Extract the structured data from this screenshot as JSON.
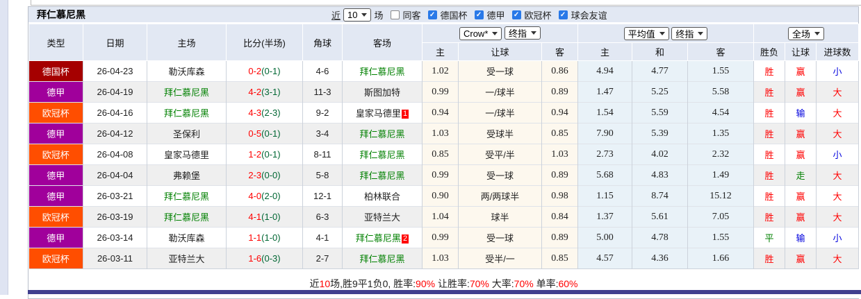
{
  "title": "拜仁慕尼黑",
  "icons": {
    "checkmark": "✓"
  },
  "colors": {
    "league_cup": "#a50000",
    "league_liga": "#a0009b",
    "league_ucl": "#ff4e00",
    "win_red": "#ff0000",
    "draw_green": "#008000",
    "lose_blue": "#0000dd",
    "header_bg": "#e2e8f3",
    "crow_col_bg": "#fdf8ee",
    "avg_col_bg": "#e9f2f8",
    "bottom_bar": "#403f8e"
  },
  "filters": {
    "recent_label": "近",
    "recent_value": "10",
    "recent_suffix": "场",
    "checkboxes": [
      {
        "label": "同客",
        "state": "off"
      },
      {
        "label": "德国杯",
        "state": "on"
      },
      {
        "label": "德甲",
        "state": "on"
      },
      {
        "label": "欧冠杯",
        "state": "on"
      },
      {
        "label": "球会友谊",
        "state": "on"
      }
    ]
  },
  "header": {
    "selects": {
      "source": "Crow*",
      "final1": "终指",
      "average": "平均值",
      "final2": "终指",
      "scope": "全场"
    },
    "columns": [
      "类型",
      "日期",
      "主场",
      "比分(半场)",
      "角球",
      "客场"
    ],
    "odds_columns": [
      "主",
      "让球",
      "客"
    ],
    "avg_columns": [
      "主",
      "和",
      "客"
    ],
    "result_columns": [
      "胜负",
      "让球",
      "进球数"
    ]
  },
  "rows": [
    {
      "league": "德国杯",
      "league_code": "cup",
      "date": "26-04-23",
      "home": "勒沃库森",
      "home_color": "black",
      "home_badge": "",
      "score": "0-2",
      "half": "(0-1)",
      "corner": "4-6",
      "away": "拜仁慕尼黑",
      "away_color": "green",
      "away_badge": "",
      "o_home": "1.02",
      "o_hcp": "受一球",
      "o_away": "0.86",
      "a_home": "4.94",
      "a_draw": "4.77",
      "a_away": "1.55",
      "r_wdl": "胜",
      "r_wdl_c": "red",
      "r_hcp": "赢",
      "r_hcp_c": "red",
      "r_ou": "小",
      "r_ou_c": "blue"
    },
    {
      "league": "德甲",
      "league_code": "liga",
      "date": "26-04-19",
      "home": "拜仁慕尼黑",
      "home_color": "green",
      "home_badge": "",
      "score": "4-2",
      "half": "(3-1)",
      "corner": "11-3",
      "away": "斯图加特",
      "away_color": "black",
      "away_badge": "",
      "o_home": "0.99",
      "o_hcp": "一/球半",
      "o_away": "0.89",
      "a_home": "1.47",
      "a_draw": "5.25",
      "a_away": "5.58",
      "r_wdl": "胜",
      "r_wdl_c": "red",
      "r_hcp": "赢",
      "r_hcp_c": "red",
      "r_ou": "大",
      "r_ou_c": "red"
    },
    {
      "league": "欧冠杯",
      "league_code": "ucl",
      "date": "26-04-16",
      "home": "拜仁慕尼黑",
      "home_color": "green",
      "home_badge": "",
      "score": "4-3",
      "half": "(2-3)",
      "corner": "9-2",
      "away": "皇家马德里",
      "away_color": "black",
      "away_badge": "1",
      "o_home": "0.94",
      "o_hcp": "一/球半",
      "o_away": "0.94",
      "a_home": "1.54",
      "a_draw": "5.59",
      "a_away": "4.54",
      "r_wdl": "胜",
      "r_wdl_c": "red",
      "r_hcp": "输",
      "r_hcp_c": "blue",
      "r_ou": "大",
      "r_ou_c": "red"
    },
    {
      "league": "德甲",
      "league_code": "liga",
      "date": "26-04-12",
      "home": "圣保利",
      "home_color": "black",
      "home_badge": "",
      "score": "0-5",
      "half": "(0-1)",
      "corner": "3-4",
      "away": "拜仁慕尼黑",
      "away_color": "green",
      "away_badge": "",
      "o_home": "1.03",
      "o_hcp": "受球半",
      "o_away": "0.85",
      "a_home": "7.90",
      "a_draw": "5.39",
      "a_away": "1.35",
      "r_wdl": "胜",
      "r_wdl_c": "red",
      "r_hcp": "赢",
      "r_hcp_c": "red",
      "r_ou": "大",
      "r_ou_c": "red"
    },
    {
      "league": "欧冠杯",
      "league_code": "ucl",
      "date": "26-04-08",
      "home": "皇家马德里",
      "home_color": "black",
      "home_badge": "",
      "score": "1-2",
      "half": "(0-1)",
      "corner": "8-11",
      "away": "拜仁慕尼黑",
      "away_color": "green",
      "away_badge": "",
      "o_home": "0.85",
      "o_hcp": "受平/半",
      "o_away": "1.03",
      "a_home": "2.73",
      "a_draw": "4.02",
      "a_away": "2.32",
      "r_wdl": "胜",
      "r_wdl_c": "red",
      "r_hcp": "赢",
      "r_hcp_c": "red",
      "r_ou": "小",
      "r_ou_c": "blue"
    },
    {
      "league": "德甲",
      "league_code": "liga",
      "date": "26-04-04",
      "home": "弗赖堡",
      "home_color": "black",
      "home_badge": "",
      "score": "2-3",
      "half": "(0-0)",
      "corner": "5-8",
      "away": "拜仁慕尼黑",
      "away_color": "green",
      "away_badge": "",
      "o_home": "0.99",
      "o_hcp": "受一球",
      "o_away": "0.89",
      "a_home": "5.68",
      "a_draw": "4.83",
      "a_away": "1.49",
      "r_wdl": "胜",
      "r_wdl_c": "red",
      "r_hcp": "走",
      "r_hcp_c": "green",
      "r_ou": "大",
      "r_ou_c": "red"
    },
    {
      "league": "德甲",
      "league_code": "liga",
      "date": "26-03-21",
      "home": "拜仁慕尼黑",
      "home_color": "green",
      "home_badge": "",
      "score": "4-0",
      "half": "(2-0)",
      "corner": "12-1",
      "away": "柏林联合",
      "away_color": "black",
      "away_badge": "",
      "o_home": "0.90",
      "o_hcp": "两/两球半",
      "o_away": "0.98",
      "a_home": "1.15",
      "a_draw": "8.74",
      "a_away": "15.12",
      "r_wdl": "胜",
      "r_wdl_c": "red",
      "r_hcp": "赢",
      "r_hcp_c": "red",
      "r_ou": "大",
      "r_ou_c": "red"
    },
    {
      "league": "欧冠杯",
      "league_code": "ucl",
      "date": "26-03-19",
      "home": "拜仁慕尼黑",
      "home_color": "green",
      "home_badge": "",
      "score": "4-1",
      "half": "(1-0)",
      "corner": "6-3",
      "away": "亚特兰大",
      "away_color": "black",
      "away_badge": "",
      "o_home": "1.04",
      "o_hcp": "球半",
      "o_away": "0.84",
      "a_home": "1.37",
      "a_draw": "5.61",
      "a_away": "7.05",
      "r_wdl": "胜",
      "r_wdl_c": "red",
      "r_hcp": "赢",
      "r_hcp_c": "red",
      "r_ou": "大",
      "r_ou_c": "red"
    },
    {
      "league": "德甲",
      "league_code": "liga",
      "date": "26-03-14",
      "home": "勒沃库森",
      "home_color": "black",
      "home_badge": "",
      "score": "1-1",
      "half": "(1-0)",
      "corner": "4-1",
      "away": "拜仁慕尼黑",
      "away_color": "green",
      "away_badge": "2",
      "o_home": "0.99",
      "o_hcp": "受一球",
      "o_away": "0.89",
      "a_home": "5.00",
      "a_draw": "4.78",
      "a_away": "1.55",
      "r_wdl": "平",
      "r_wdl_c": "green",
      "r_hcp": "输",
      "r_hcp_c": "blue",
      "r_ou": "小",
      "r_ou_c": "blue"
    },
    {
      "league": "欧冠杯",
      "league_code": "ucl",
      "date": "26-03-11",
      "home": "亚特兰大",
      "home_color": "black",
      "home_badge": "",
      "score": "1-6",
      "half": "(0-3)",
      "corner": "2-7",
      "away": "拜仁慕尼黑",
      "away_color": "green",
      "away_badge": "",
      "o_home": "1.03",
      "o_hcp": "受半/一",
      "o_away": "0.85",
      "a_home": "4.57",
      "a_draw": "4.36",
      "a_away": "1.66",
      "r_wdl": "胜",
      "r_wdl_c": "red",
      "r_hcp": "赢",
      "r_hcp_c": "red",
      "r_ou": "大",
      "r_ou_c": "red"
    }
  ],
  "summary": {
    "segments": [
      {
        "t": "近",
        "c": "black"
      },
      {
        "t": "10",
        "c": "red"
      },
      {
        "t": "场,胜9平1负0, 胜率:",
        "c": "black"
      },
      {
        "t": "90%",
        "c": "red"
      },
      {
        "t": " 让胜率:",
        "c": "black"
      },
      {
        "t": "70%",
        "c": "red"
      },
      {
        "t": " 大率:",
        "c": "black"
      },
      {
        "t": "70%",
        "c": "red"
      },
      {
        "t": " 单率:",
        "c": "black"
      },
      {
        "t": "60%",
        "c": "red"
      }
    ]
  }
}
